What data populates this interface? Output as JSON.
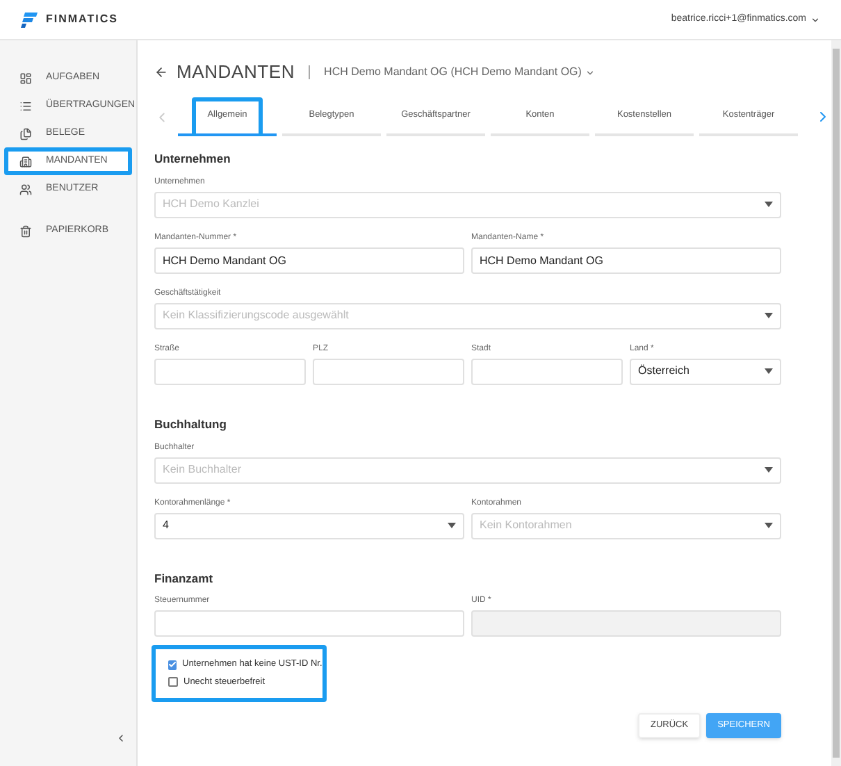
{
  "header": {
    "brand": "FINMATICS",
    "user": "beatrice.ricci+1@finmatics.com"
  },
  "sidebar": {
    "items": [
      {
        "label": "AUFGABEN",
        "selected": false
      },
      {
        "label": "ÜBERTRAGUNGEN",
        "selected": false
      },
      {
        "label": "BELEGE",
        "selected": false
      },
      {
        "label": "MANDANTEN",
        "selected": true
      },
      {
        "label": "BENUTZER",
        "selected": false
      },
      {
        "label": "PAPIERKORB",
        "selected": false
      }
    ]
  },
  "page": {
    "title": "MANDANTEN",
    "subtitle": "HCH Demo Mandant OG (HCH Demo Mandant OG)"
  },
  "tabs": [
    {
      "label": "Allgemein",
      "selected": true,
      "highlighted": true
    },
    {
      "label": "Belegtypen",
      "selected": false,
      "highlighted": false
    },
    {
      "label": "Geschäftspartner",
      "selected": false,
      "highlighted": false
    },
    {
      "label": "Konten",
      "selected": false,
      "highlighted": false
    },
    {
      "label": "Kostenstellen",
      "selected": false,
      "highlighted": false
    },
    {
      "label": "Kostenträger",
      "selected": false,
      "highlighted": false
    }
  ],
  "sections": [
    {
      "title": "Unternehmen",
      "groups": [
        {
          "fields": [
            {
              "label": "Unternehmen",
              "kind": "select",
              "placeholder": "HCH Demo Kanzlei"
            }
          ]
        },
        {
          "fields": [
            {
              "label": "Mandanten-Nummer *",
              "kind": "text",
              "value": "HCH Demo Mandant OG"
            },
            {
              "label": "Mandanten-Name *",
              "kind": "text",
              "value": "HCH Demo Mandant OG"
            }
          ]
        },
        {
          "fields": [
            {
              "label": "Geschäftstätigkeit",
              "kind": "select",
              "placeholder": "Kein Klassifizierungscode ausgewählt"
            }
          ]
        },
        {
          "fields": [
            {
              "label": "Straße",
              "kind": "text"
            },
            {
              "label": "PLZ",
              "kind": "text"
            },
            {
              "label": "Stadt",
              "kind": "text"
            },
            {
              "label": "Land *",
              "kind": "select",
              "value": "Österreich"
            }
          ]
        }
      ]
    },
    {
      "title": "Buchhaltung",
      "groups": [
        {
          "fields": [
            {
              "label": "Buchhalter",
              "kind": "select",
              "placeholder": "Kein Buchhalter"
            }
          ]
        },
        {
          "fields": [
            {
              "label": "Kontorahmenlänge *",
              "kind": "select",
              "value": "4"
            },
            {
              "label": "Kontorahmen",
              "kind": "select",
              "placeholder": "Kein Kontorahmen"
            }
          ]
        }
      ]
    },
    {
      "title": "Finanzamt",
      "groups": [
        {
          "fields": [
            {
              "label": "Steuernummer",
              "kind": "text"
            },
            {
              "label": "UID *",
              "kind": "disabled"
            }
          ]
        }
      ]
    }
  ],
  "options": {
    "highlighted": true,
    "items": [
      {
        "label": "Unternehmen hat keine UST-ID Nr.",
        "checked": true
      },
      {
        "label": "Unecht steuerbefreit",
        "checked": false
      }
    ]
  },
  "buttons": [
    {
      "label": "ZURÜCK",
      "kind": "secondary"
    },
    {
      "label": "SPEICHERN",
      "kind": "primary"
    }
  ]
}
